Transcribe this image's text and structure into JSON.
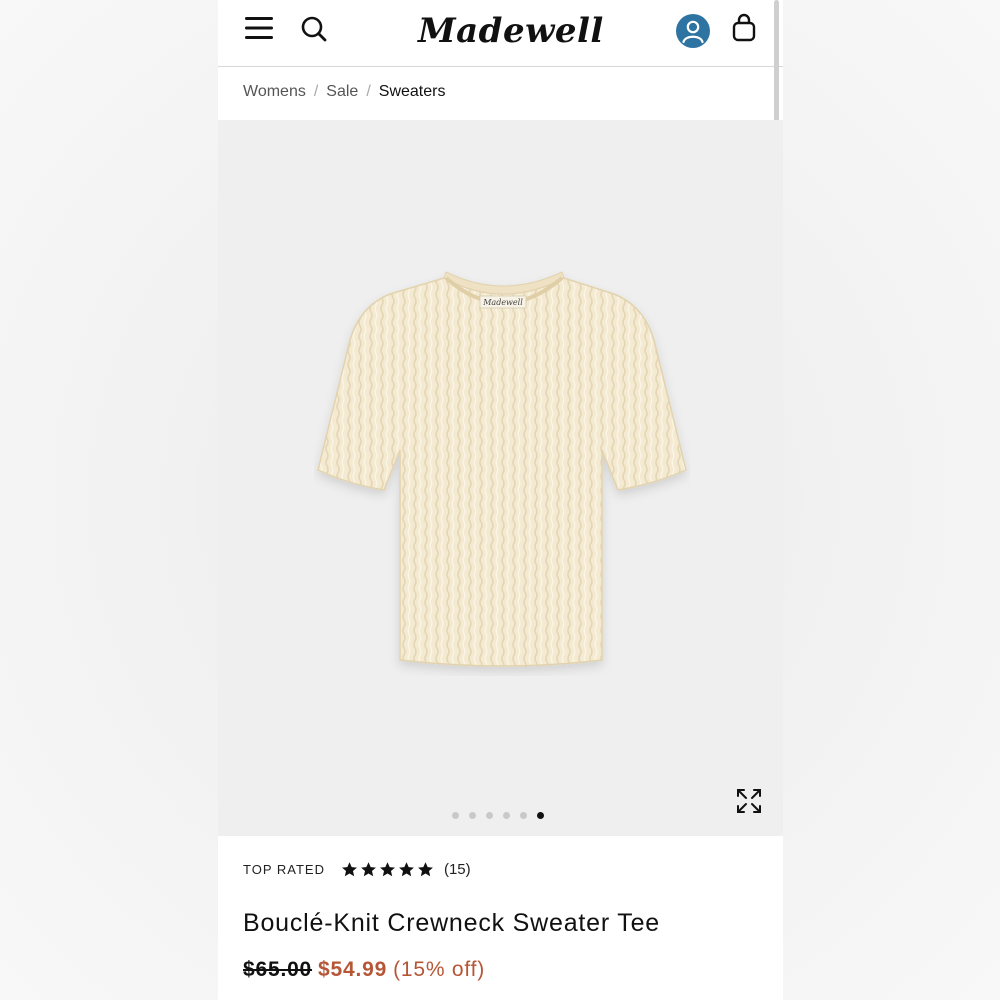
{
  "header": {
    "logo_text": "Madewell",
    "icons": [
      "menu-icon",
      "search-icon",
      "account-icon",
      "bag-icon"
    ],
    "account_color": "#2e74a3"
  },
  "breadcrumb": {
    "items": [
      "Womens",
      "Sale",
      "Sweaters"
    ],
    "separator": "/"
  },
  "gallery": {
    "label_text": "Madewell",
    "dot_count": 6,
    "active_dot": 6,
    "expand_icon": "expand-icon",
    "sweater_color": "#f4ead1"
  },
  "product": {
    "badge": "TOP RATED",
    "rating_stars": 5,
    "review_count": "(15)",
    "title": "Bouclé-Knit Crewneck Sweater Tee",
    "old_price": "$65.00",
    "sale_price": "$54.99",
    "discount": "(15% off)",
    "sale_color": "#b55637"
  }
}
